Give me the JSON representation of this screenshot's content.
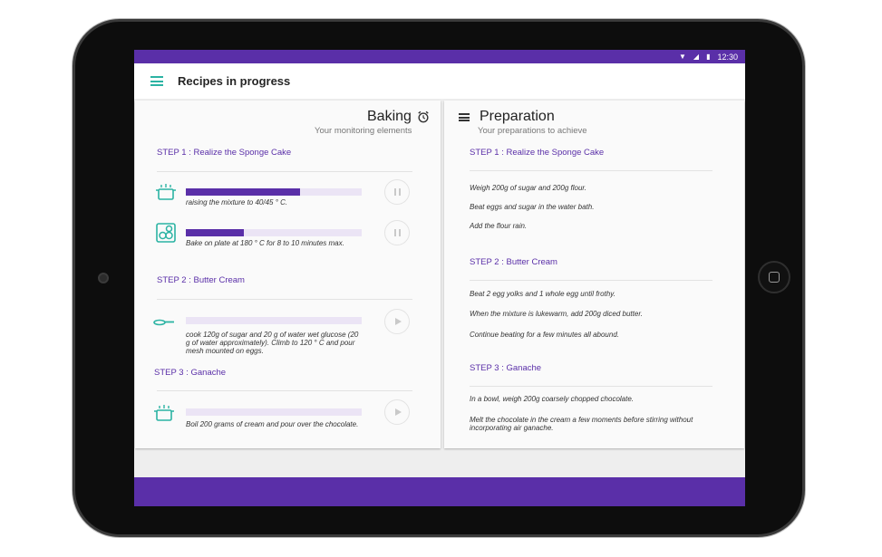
{
  "status_bar": {
    "time": "12:30"
  },
  "app_bar": {
    "title": "Recipes in progress"
  },
  "baking": {
    "title": "Baking",
    "subtitle": "Your monitoring elements",
    "steps": [
      {
        "title": "STEP 1 : Realize the Sponge Cake"
      },
      {
        "title": "STEP 2 : Butter Cream"
      },
      {
        "title": "STEP 3 : Ganache"
      }
    ],
    "tasks": [
      {
        "icon": "pot-icon",
        "text": "raising the mixture to 40/45 ° C.",
        "progress": 0.65,
        "control": "pause"
      },
      {
        "icon": "hob-icon",
        "text": "Bake on plate at 180 ° C for 8 to 10 minutes max.",
        "progress": 0.33,
        "control": "pause"
      },
      {
        "icon": "pan-icon",
        "text": "cook 120g of sugar and 20 g of water wet glucose (20 g of water approximately). Climb to 120 ° C and pour mesh mounted on eggs.",
        "progress": 0,
        "control": "play"
      },
      {
        "icon": "pot-icon",
        "text": "Boil 200 grams of cream and pour over the chocolate.",
        "progress": 0,
        "control": "play"
      }
    ]
  },
  "preparation": {
    "title": "Preparation",
    "subtitle": "Your preparations to achieve",
    "steps": [
      {
        "title": "STEP 1 : Realize the Sponge Cake",
        "lines": [
          "Weigh 200g of sugar and 200g flour.",
          "Beat eggs and sugar in the water bath.",
          "Add the flour rain."
        ]
      },
      {
        "title": "STEP 2 : Butter Cream",
        "lines": [
          "Beat 2 egg yolks and 1 whole egg until frothy.",
          "When the mixture is lukewarm, add 200g diced butter.",
          "Continue beating for a few minutes all abound."
        ]
      },
      {
        "title": "STEP 3 : Ganache",
        "lines": [
          "In a bowl, weigh 200g coarsely chopped chocolate.",
          "Melt the chocolate in the cream a few moments before stirring without incorporating air ganache."
        ]
      }
    ]
  },
  "colors": {
    "accent": "#5a2fa8",
    "teal": "#2bb3a3",
    "track": "#ebe4f5"
  }
}
